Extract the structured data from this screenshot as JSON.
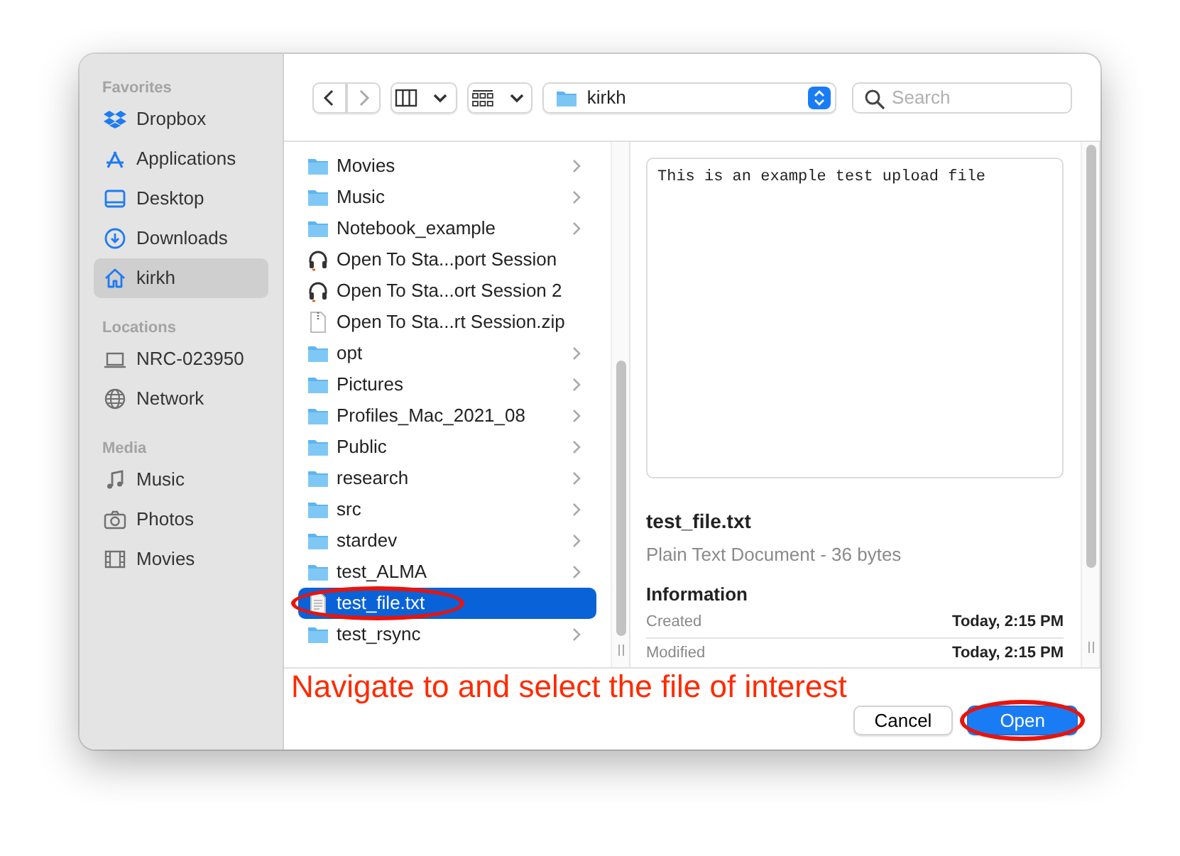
{
  "sidebar": {
    "sections": [
      {
        "heading": "Favorites",
        "items": [
          {
            "label": "Dropbox",
            "kind": "dropbox",
            "selected": false
          },
          {
            "label": "Applications",
            "kind": "apps",
            "selected": false
          },
          {
            "label": "Desktop",
            "kind": "desktop",
            "selected": false
          },
          {
            "label": "Downloads",
            "kind": "download",
            "selected": false
          },
          {
            "label": "kirkh",
            "kind": "home",
            "selected": true
          }
        ]
      },
      {
        "heading": "Locations",
        "items": [
          {
            "label": "NRC-023950",
            "kind": "laptop",
            "selected": false
          },
          {
            "label": "Network",
            "kind": "globe",
            "selected": false
          }
        ]
      },
      {
        "heading": "Media",
        "items": [
          {
            "label": "Music",
            "kind": "music",
            "selected": false
          },
          {
            "label": "Photos",
            "kind": "camera",
            "selected": false
          },
          {
            "label": "Movies",
            "kind": "film",
            "selected": false
          }
        ]
      }
    ]
  },
  "toolbar": {
    "location": "kirkh",
    "search": {
      "placeholder": "Search"
    }
  },
  "files": [
    {
      "name": "Movies",
      "kind": "folder",
      "selected": false,
      "circled": false
    },
    {
      "name": "Music",
      "kind": "folder",
      "selected": false,
      "circled": false
    },
    {
      "name": "Notebook_example",
      "kind": "folder",
      "selected": false,
      "circled": false
    },
    {
      "name": "Open To Sta...port Session",
      "kind": "audio",
      "selected": false,
      "circled": false
    },
    {
      "name": "Open To Sta...ort Session 2",
      "kind": "audio",
      "selected": false,
      "circled": false
    },
    {
      "name": "Open To Sta...rt Session.zip",
      "kind": "archive",
      "selected": false,
      "circled": false
    },
    {
      "name": "opt",
      "kind": "folder",
      "selected": false,
      "circled": false
    },
    {
      "name": "Pictures",
      "kind": "folder",
      "selected": false,
      "circled": false
    },
    {
      "name": "Profiles_Mac_2021_08",
      "kind": "folder",
      "selected": false,
      "circled": false
    },
    {
      "name": "Public",
      "kind": "folder",
      "selected": false,
      "circled": false
    },
    {
      "name": "research",
      "kind": "folder",
      "selected": false,
      "circled": false
    },
    {
      "name": "src",
      "kind": "folder",
      "selected": false,
      "circled": false
    },
    {
      "name": "stardev",
      "kind": "folder",
      "selected": false,
      "circled": false
    },
    {
      "name": "test_ALMA",
      "kind": "folder",
      "selected": false,
      "circled": false
    },
    {
      "name": "test_file.txt",
      "kind": "text",
      "selected": true,
      "circled": true
    },
    {
      "name": "test_rsync",
      "kind": "folder",
      "selected": false,
      "circled": false
    }
  ],
  "preview": {
    "content": "This is an example test upload file",
    "filename": "test_file.txt",
    "description": "Plain Text Document - 36 bytes",
    "info_heading": "Information",
    "info": [
      {
        "label": "Created",
        "value": "Today, 2:15 PM"
      },
      {
        "label": "Modified",
        "value": "Today, 2:15 PM"
      }
    ]
  },
  "annotation": "Navigate to and select the file of interest",
  "buttons": [
    {
      "label": "Cancel",
      "kind": "default",
      "circled": false
    },
    {
      "label": "Open",
      "kind": "primary",
      "circled": true
    }
  ]
}
